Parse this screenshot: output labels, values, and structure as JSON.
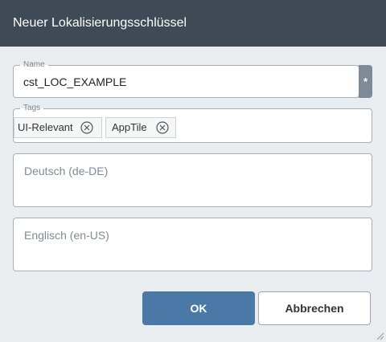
{
  "dialog": {
    "title": "Neuer Lokalisierungsschlüssel"
  },
  "name_field": {
    "legend": "Name",
    "value": "cst_LOC_EXAMPLE",
    "required_marker": "*"
  },
  "tags_field": {
    "legend": "Tags",
    "tags": [
      {
        "label": "UI-Relevant",
        "remove_icon": "close-circle-icon"
      },
      {
        "label": "AppTile",
        "remove_icon": "close-circle-icon"
      }
    ]
  },
  "translations": [
    {
      "placeholder": "Deutsch (de-DE)"
    },
    {
      "placeholder": "Englisch (en-US)"
    }
  ],
  "buttons": {
    "ok_label": "OK",
    "cancel_label": "Abbrechen"
  },
  "colors": {
    "titlebar": "#3f4a56",
    "background": "#e9edf0",
    "primary": "#4a79a8",
    "required_marker": "#7e8a97"
  }
}
